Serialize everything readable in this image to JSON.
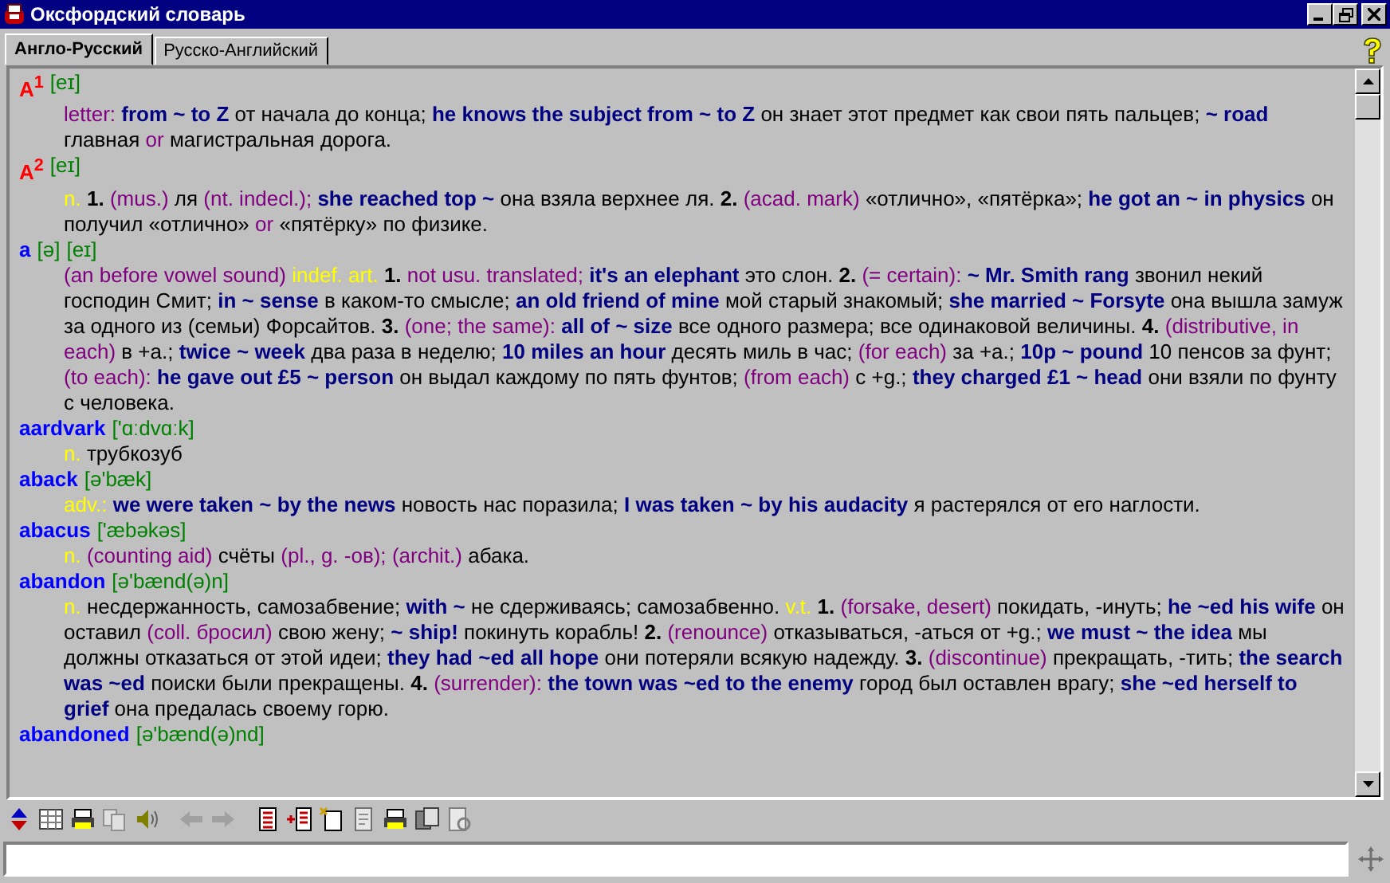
{
  "window": {
    "title": "Оксфордский словарь"
  },
  "tabs": [
    {
      "label": "Англо-Русский",
      "selected": true
    },
    {
      "label": "Русско-Английский",
      "selected": false
    }
  ],
  "entries": [
    {
      "headword": "A$^{1}$",
      "kind": "letter",
      "transcriptions": [
        "[eɪ]"
      ],
      "body": [
        {
          "kind": "note",
          "text": "letter:"
        },
        {
          "kind": "ex",
          "text": "from ~ to Z"
        },
        {
          "kind": "plain",
          "text": "от начала до конца;"
        },
        {
          "kind": "ex",
          "text": "he knows the subject from ~ to Z"
        },
        {
          "kind": "plain",
          "text": "он знает этот предмет как свои пять пальцев;"
        },
        {
          "kind": "ex",
          "text": "~ road"
        },
        {
          "kind": "plain",
          "text": "главная"
        },
        {
          "kind": "note",
          "text": "or"
        },
        {
          "kind": "plain",
          "text": "магистральная дорога."
        }
      ]
    },
    {
      "headword": "A$^{2}$",
      "kind": "letter",
      "transcriptions": [
        "[eɪ]"
      ],
      "body": [
        {
          "kind": "pos",
          "text": "n."
        },
        {
          "kind": "num",
          "text": "1."
        },
        {
          "kind": "note",
          "text": "(mus.)"
        },
        {
          "kind": "plain",
          "text": "ля"
        },
        {
          "kind": "note",
          "text": "(nt. indecl.);"
        },
        {
          "kind": "ex",
          "text": "she reached top ~"
        },
        {
          "kind": "plain",
          "text": "она взяла верхнее ля."
        },
        {
          "kind": "num",
          "text": "2."
        },
        {
          "kind": "note",
          "text": "(acad. mark)"
        },
        {
          "kind": "plain",
          "text": "«отлично», «пятёрка»;"
        },
        {
          "kind": "ex",
          "text": "he got an ~ in physics"
        },
        {
          "kind": "plain",
          "text": "он получил «отлично»"
        },
        {
          "kind": "note",
          "text": "or"
        },
        {
          "kind": "plain",
          "text": "«пятёрку» по физике."
        }
      ]
    },
    {
      "headword": "a",
      "kind": "word",
      "transcriptions": [
        "[ə]",
        "[eɪ]"
      ],
      "body": [
        {
          "kind": "note",
          "text": "(an before vowel sound)"
        },
        {
          "kind": "pos",
          "text": "indef. art."
        },
        {
          "kind": "num",
          "text": "1."
        },
        {
          "kind": "note",
          "text": "not usu. translated;"
        },
        {
          "kind": "ex",
          "text": "it's an elephant"
        },
        {
          "kind": "plain",
          "text": "это слон."
        },
        {
          "kind": "num",
          "text": "2."
        },
        {
          "kind": "note",
          "text": "(= certain):"
        },
        {
          "kind": "ex",
          "text": "~ Mr. Smith rang"
        },
        {
          "kind": "plain",
          "text": "звонил некий господин Смит;"
        },
        {
          "kind": "ex",
          "text": "in ~ sense"
        },
        {
          "kind": "plain",
          "text": "в каком-то смысле;"
        },
        {
          "kind": "ex",
          "text": "an old friend of mine"
        },
        {
          "kind": "plain",
          "text": "мой старый знакомый;"
        },
        {
          "kind": "ex",
          "text": "she married ~ Forsyte"
        },
        {
          "kind": "plain",
          "text": "она вышла замуж за одного из (семьи) Форсайтов."
        },
        {
          "kind": "num",
          "text": "3."
        },
        {
          "kind": "note",
          "text": "(one; the same):"
        },
        {
          "kind": "ex",
          "text": "all of ~ size"
        },
        {
          "kind": "plain",
          "text": "все одного размера; все одинаковой величины."
        },
        {
          "kind": "num",
          "text": "4."
        },
        {
          "kind": "note",
          "text": "(distributive, in each)"
        },
        {
          "kind": "plain",
          "text": "в +a.;"
        },
        {
          "kind": "ex",
          "text": "twice ~ week"
        },
        {
          "kind": "plain",
          "text": "два раза в неделю;"
        },
        {
          "kind": "ex",
          "text": "10 miles an hour"
        },
        {
          "kind": "plain",
          "text": "десять миль в час;"
        },
        {
          "kind": "note",
          "text": "(for each)"
        },
        {
          "kind": "plain",
          "text": "за +a.;"
        },
        {
          "kind": "ex",
          "text": "10p ~ pound"
        },
        {
          "kind": "plain",
          "text": "10 пенсов за фунт;"
        },
        {
          "kind": "note",
          "text": "(to each):"
        },
        {
          "kind": "ex",
          "text": "he gave out £5 ~ person"
        },
        {
          "kind": "plain",
          "text": "он выдал каждому по пять фунтов;"
        },
        {
          "kind": "note",
          "text": "(from each)"
        },
        {
          "kind": "plain",
          "text": "с +g.;"
        },
        {
          "kind": "ex",
          "text": "they charged £1 ~ head"
        },
        {
          "kind": "plain",
          "text": "они взяли по фунту с человека."
        }
      ]
    },
    {
      "headword": "aardvark",
      "kind": "word",
      "transcriptions": [
        "['ɑːdvɑːk]"
      ],
      "body": [
        {
          "kind": "pos",
          "text": "n."
        },
        {
          "kind": "plain",
          "text": "трубкозуб"
        }
      ]
    },
    {
      "headword": "aback",
      "kind": "word",
      "transcriptions": [
        "[ə'bæk]"
      ],
      "body": [
        {
          "kind": "pos",
          "text": "adv.:"
        },
        {
          "kind": "ex",
          "text": "we were taken ~ by the news"
        },
        {
          "kind": "plain",
          "text": "новость нас поразила;"
        },
        {
          "kind": "ex",
          "text": "I was taken ~ by his audacity"
        },
        {
          "kind": "plain",
          "text": "я растерялся от его наглости."
        }
      ]
    },
    {
      "headword": "abacus",
      "kind": "word",
      "transcriptions": [
        "['æbəkəs]"
      ],
      "body": [
        {
          "kind": "pos",
          "text": "n."
        },
        {
          "kind": "note",
          "text": "(counting aid)"
        },
        {
          "kind": "plain",
          "text": "счёты"
        },
        {
          "kind": "note",
          "text": "(pl., g. -ов);"
        },
        {
          "kind": "note",
          "text": "(archit.)"
        },
        {
          "kind": "plain",
          "text": "абака."
        }
      ]
    },
    {
      "headword": "abandon",
      "kind": "word",
      "transcriptions": [
        "[ə'bænd(ə)n]"
      ],
      "body": [
        {
          "kind": "pos",
          "text": "n."
        },
        {
          "kind": "plain",
          "text": "несдержанность, самозабвение;"
        },
        {
          "kind": "ex",
          "text": "with ~"
        },
        {
          "kind": "plain",
          "text": "не сдерживаясь; самозабвенно."
        },
        {
          "kind": "pos",
          "text": "v.t."
        },
        {
          "kind": "num",
          "text": "1."
        },
        {
          "kind": "note",
          "text": "(forsake, desert)"
        },
        {
          "kind": "plain",
          "text": "покидать, -инуть;"
        },
        {
          "kind": "ex",
          "text": "he ~ed his wife"
        },
        {
          "kind": "plain",
          "text": "он оставил"
        },
        {
          "kind": "note",
          "text": "(coll. бросил)"
        },
        {
          "kind": "plain",
          "text": "свою жену;"
        },
        {
          "kind": "ex",
          "text": "~ ship!"
        },
        {
          "kind": "plain",
          "text": "покинуть корабль!"
        },
        {
          "kind": "num",
          "text": "2."
        },
        {
          "kind": "note",
          "text": "(renounce)"
        },
        {
          "kind": "plain",
          "text": "отказываться, -аться от +g.;"
        },
        {
          "kind": "ex",
          "text": "we must ~ the idea"
        },
        {
          "kind": "plain",
          "text": "мы должны отказаться от этой идеи;"
        },
        {
          "kind": "ex",
          "text": "they had ~ed all hope"
        },
        {
          "kind": "plain",
          "text": "они потеряли всякую надежду."
        },
        {
          "kind": "num",
          "text": "3."
        },
        {
          "kind": "note",
          "text": "(discontinue)"
        },
        {
          "kind": "plain",
          "text": "прекращать, -тить;"
        },
        {
          "kind": "ex",
          "text": "the search was ~ed"
        },
        {
          "kind": "plain",
          "text": "поиски были прекращены."
        },
        {
          "kind": "num",
          "text": "4."
        },
        {
          "kind": "note",
          "text": "(surrender):"
        },
        {
          "kind": "ex",
          "text": "the town was ~ed to the enemy"
        },
        {
          "kind": "plain",
          "text": "город был оставлен врагу;"
        },
        {
          "kind": "ex",
          "text": "she ~ed herself to grief"
        },
        {
          "kind": "plain",
          "text": "она предалась своему горю."
        }
      ]
    },
    {
      "headword": "abandoned",
      "kind": "word",
      "transcriptions": [
        "[ə'bænd(ə)nd]"
      ]
    }
  ]
}
